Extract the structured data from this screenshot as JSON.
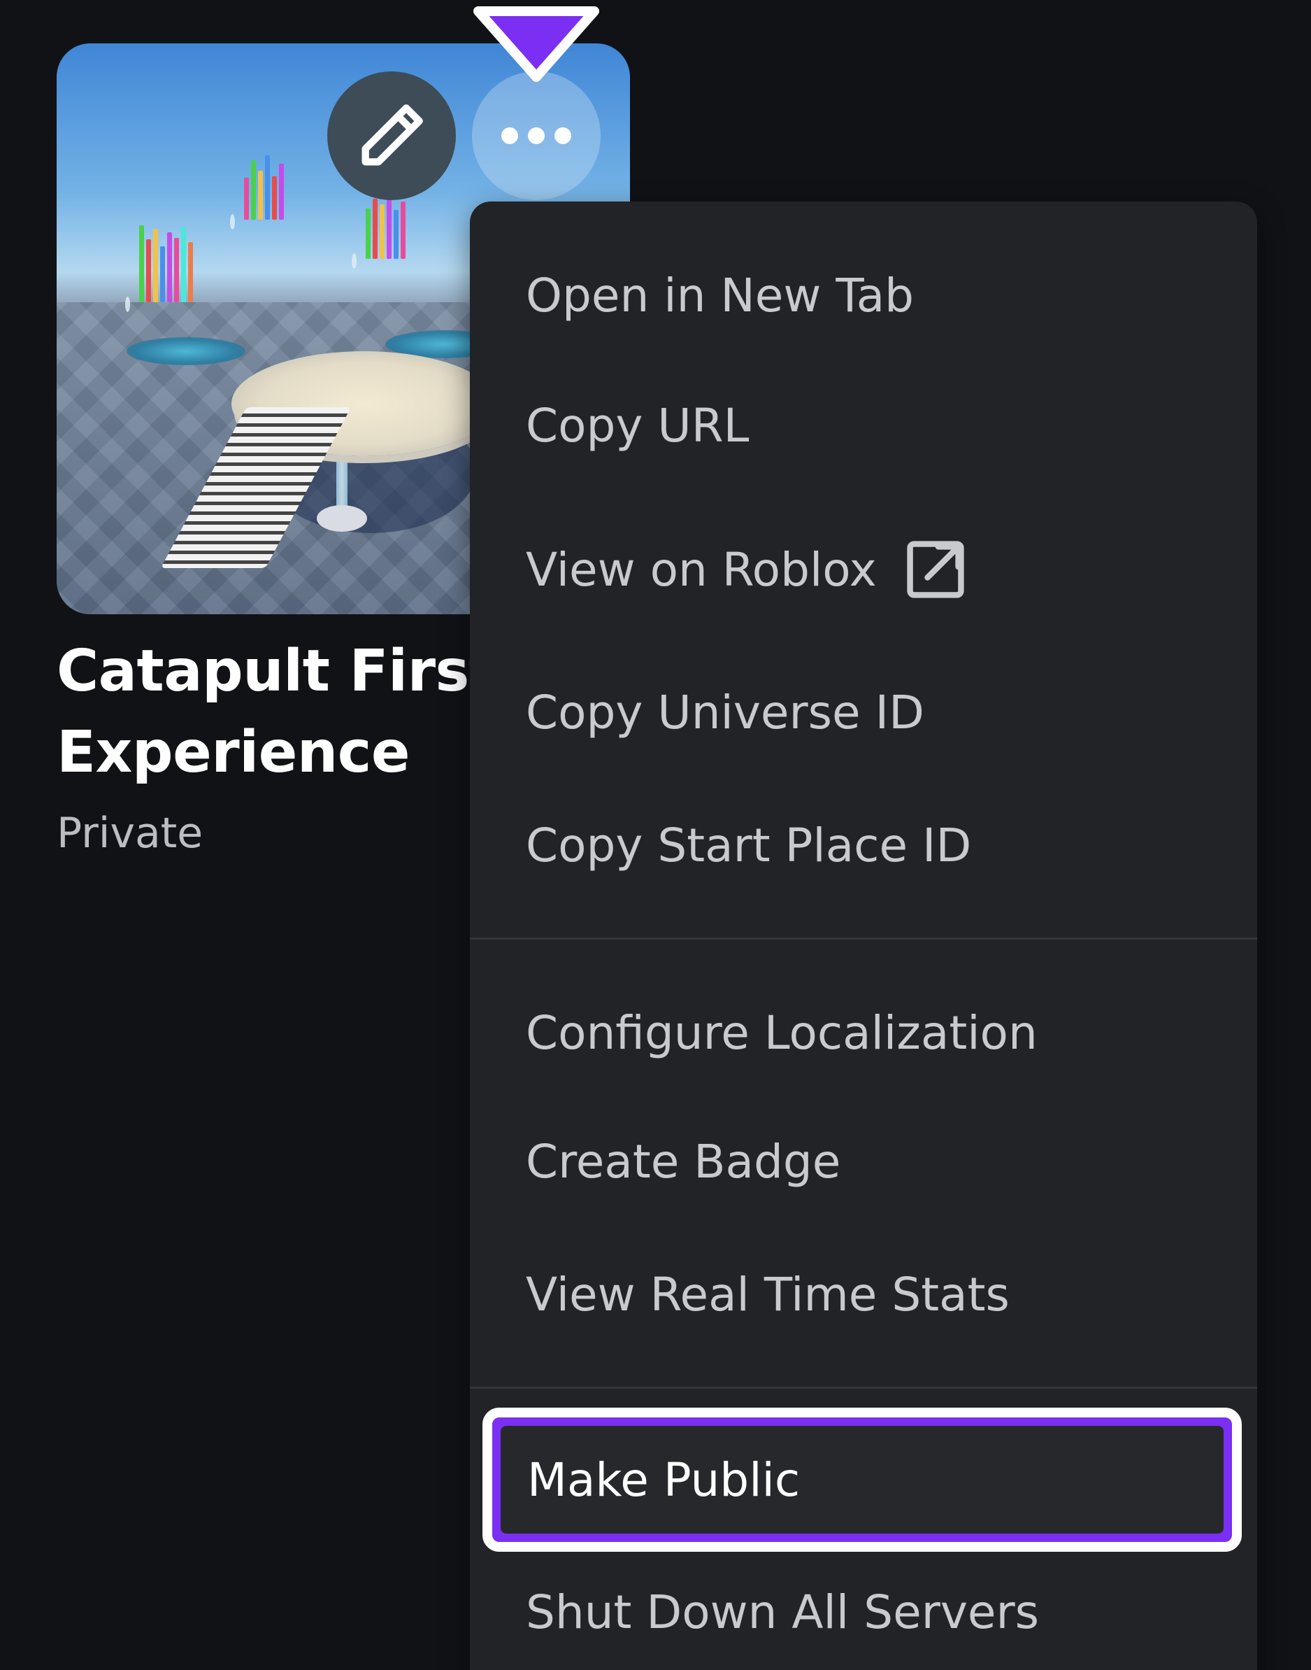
{
  "card": {
    "title": "Catapult First Experience",
    "status": "Private",
    "edit_icon": "pencil-icon",
    "more_icon": "more-horizontal-icon"
  },
  "marker": {
    "icon": "pointer-triangle-icon",
    "color": "#7b2ff2"
  },
  "menu": {
    "items": [
      {
        "label": "Open in New Tab"
      },
      {
        "label": "Copy URL"
      },
      {
        "label": "View on Roblox",
        "icon": "external-link-icon"
      },
      {
        "label": "Copy Universe ID"
      },
      {
        "label": "Copy Start Place ID"
      },
      {
        "label": "Configure Localization"
      },
      {
        "label": "Create Badge"
      },
      {
        "label": "View Real Time Stats"
      },
      {
        "label": "Make Public",
        "focused": true
      },
      {
        "label": "Shut Down All Servers"
      }
    ]
  },
  "colors": {
    "background": "#111216",
    "menu_background": "#222327",
    "menu_text": "#c9cace",
    "focus_ring": "#7b2ff2"
  }
}
